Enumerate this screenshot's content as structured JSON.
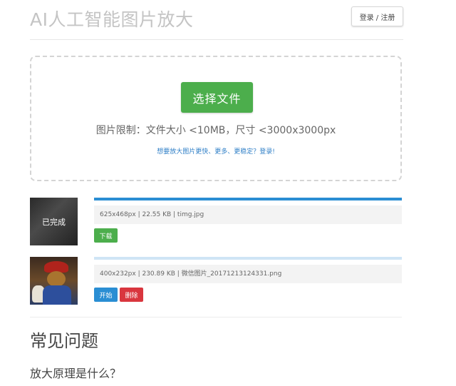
{
  "header": {
    "title": "AI人工智能图片放大",
    "login_label": "登录 / 注册"
  },
  "upload": {
    "choose_label": "选择文件",
    "limit_text": "图片限制：文件大小 <10MB，尺寸 <3000x3000px",
    "promo_text": "想要放大图片更快、更多、更稳定？登录!"
  },
  "files": [
    {
      "status_label": "已完成",
      "meta": "625x468px | 22.55 KB | timg.jpg",
      "progress": 1.0,
      "actions": {
        "download": "下载"
      }
    },
    {
      "meta": "400x232px | 230.89 KB | 微信图片_20171213124331.png",
      "progress": 0.0,
      "actions": {
        "start": "开始",
        "delete": "删除"
      }
    }
  ],
  "faq": {
    "title": "常见问题",
    "question_1": "放大原理是什么？"
  },
  "colors": {
    "success": "#4cae4c",
    "primary": "#2a8ed3",
    "danger": "#d9363e"
  }
}
